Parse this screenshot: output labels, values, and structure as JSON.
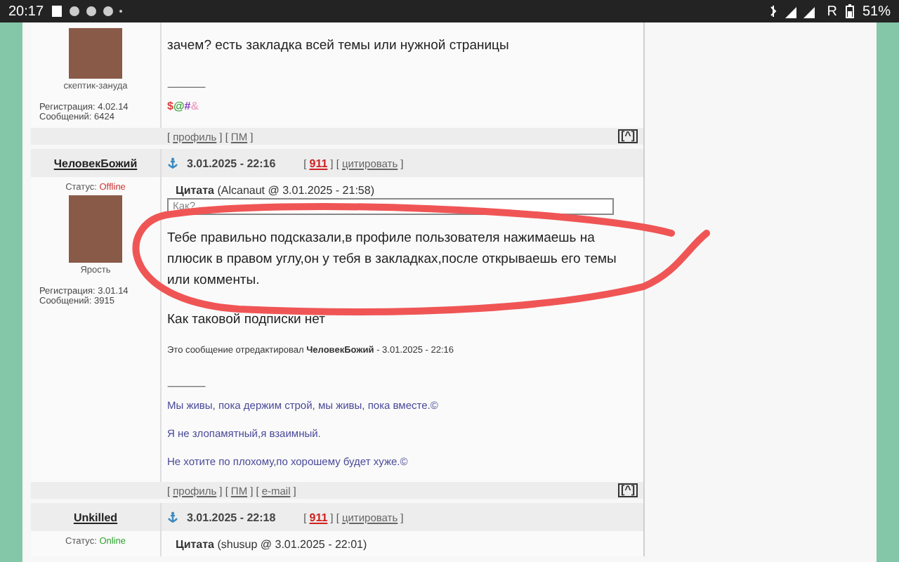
{
  "status_bar": {
    "time": "20:17",
    "network": "R",
    "battery": "51%"
  },
  "posts": [
    {
      "author": "скептик-зануда",
      "info": [
        "Регистрация: 4.02.14",
        "Сообщений: 6424"
      ],
      "paragraphs": [
        "зачем? есть закладка всей темы или нужной страницы"
      ],
      "signature_rule": "--------------------",
      "signature_marks": [
        {
          "text": "$",
          "color": "#e03a3a"
        },
        {
          "text": "@",
          "color": "#3aa03a"
        },
        {
          "text": "#",
          "color": "#9040c0"
        },
        {
          "text": "&",
          "color": "#f0a8c8"
        }
      ],
      "footer": [
        {
          "kind": "text",
          "text": "["
        },
        {
          "kind": "link",
          "text": "профиль"
        },
        {
          "kind": "text",
          "text": "] ["
        },
        {
          "kind": "link",
          "text": "ПМ"
        },
        {
          "kind": "text",
          "text": "]"
        }
      ],
      "top_link": "[^]"
    },
    {
      "author": "Ярость",
      "header": {
        "name": "ЧеловекБожий",
        "date": "3.01.2025 - 22:16",
        "actions": [
          {
            "kind": "text",
            "text": "["
          },
          {
            "kind": "count",
            "text": "911"
          },
          {
            "kind": "text",
            "text": "] ["
          },
          {
            "kind": "link",
            "text": "цитировать"
          },
          {
            "kind": "text",
            "text": "]"
          }
        ]
      },
      "status": {
        "label": "Статус:",
        "value": "Offline",
        "online": false
      },
      "info": [
        "Регистрация: 3.01.14",
        "Сообщений: 3915"
      ],
      "quote": {
        "title": "Цитата",
        "meta": "(Alcanaut @ 3.01.2025 - 21:58)",
        "text": "Как?"
      },
      "paragraphs": [
        "Тебе правильно подсказали,в профиле пользователя нажимаешь на плюсик в правом углу,он у тебя в закладках,после открываешь его темы или комменты.",
        "Как таковой подписки нет"
      ],
      "edited": {
        "text": "Это сообщение отредактировал",
        "name": "ЧеловекБожий",
        "date": "- 3.01.2025 - 22:16"
      },
      "signature_rule": "--------------------",
      "signature_lines": [
        "Мы живы, пока держим строй, мы живы, пока вместе.©",
        "Я не злопамятный,я взаимный.",
        "Не хотите по плохому,по хорошему будет хуже.©"
      ],
      "footer": [
        {
          "kind": "text",
          "text": "["
        },
        {
          "kind": "link",
          "text": "профиль"
        },
        {
          "kind": "text",
          "text": "] ["
        },
        {
          "kind": "link",
          "text": "ПМ"
        },
        {
          "kind": "text",
          "text": "] ["
        },
        {
          "kind": "link",
          "text": "e-mail"
        },
        {
          "kind": "text",
          "text": "]"
        }
      ],
      "top_link": "[^]"
    },
    {
      "header": {
        "name": "Unkilled",
        "date": "3.01.2025 - 22:18",
        "actions": [
          {
            "kind": "text",
            "text": "["
          },
          {
            "kind": "count",
            "text": "911"
          },
          {
            "kind": "text",
            "text": "] ["
          },
          {
            "kind": "link",
            "text": "цитировать"
          },
          {
            "kind": "text",
            "text": "]"
          }
        ]
      },
      "status": {
        "label": "Статус:",
        "value": "Online",
        "online": true
      },
      "quote": {
        "title": "Цитата",
        "meta": "(shusup @ 3.01.2025 - 22:01)"
      }
    }
  ]
}
